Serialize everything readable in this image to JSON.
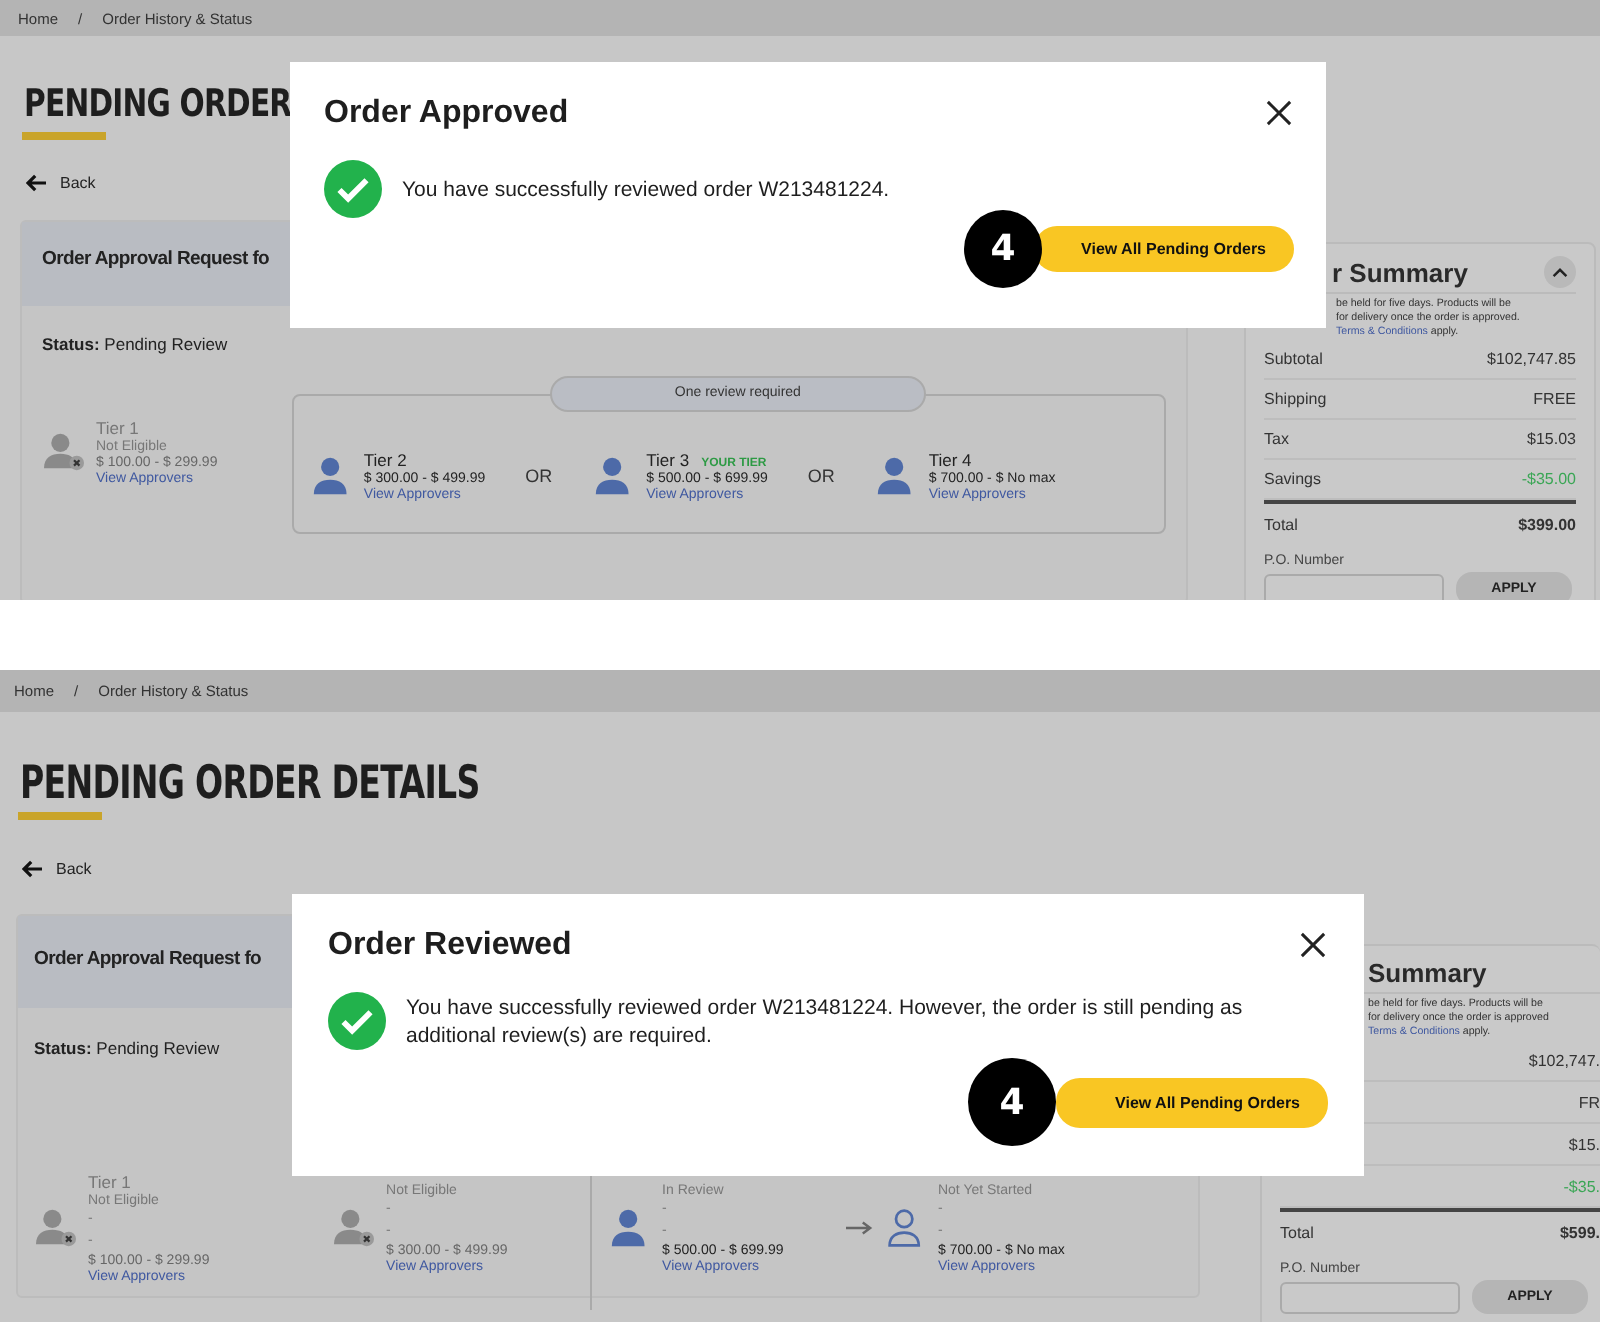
{
  "screens": [
    {
      "breadcrumb": [
        "Home",
        "Order History & Status"
      ],
      "separator": "/",
      "heading": "PENDING ORDER",
      "back": "Back",
      "request_title": "Order Approval Request fo",
      "status_label": "Status:",
      "status_value": "Pending Review",
      "tiers": [
        {
          "kind": "tier",
          "name": "Tier 1",
          "status": "Not Eligible",
          "range": "$ 100.00 - $ 299.99",
          "link": "View Approvers",
          "eligible": false
        },
        {
          "kind": "group",
          "label": "One review required",
          "items": [
            {
              "kind": "tier",
              "name": "Tier 2",
              "range": "$ 300.00 - $ 499.99",
              "link": "View Approvers",
              "eligible": true,
              "started": true
            },
            {
              "kind": "or",
              "text": "OR"
            },
            {
              "kind": "tier",
              "name": "Tier 3",
              "badge": "YOUR TIER",
              "range": "$ 500.00 - $ 699.99",
              "link": "View Approvers",
              "eligible": true,
              "started": true
            },
            {
              "kind": "or",
              "text": "OR"
            },
            {
              "kind": "tier",
              "name": "Tier 4",
              "range": "$ 700.00 - $ No max",
              "link": "View Approvers",
              "eligible": true,
              "started": true
            }
          ]
        }
      ],
      "summary": {
        "heading": "r Summary",
        "collapse": true,
        "note_lines": [
          "be held for five days. Products will be",
          "for delivery once the order is approved."
        ],
        "note_link": "Terms & Conditions",
        "note_tail": "apply.",
        "rows": [
          {
            "label": "Subtotal",
            "value": "$102,747.85",
            "kind": "plain"
          },
          {
            "label": "Shipping",
            "value": "FREE",
            "kind": "plain"
          },
          {
            "label": "Tax",
            "value": "$15.03",
            "kind": "plain"
          },
          {
            "label": "Savings",
            "value": "-$35.00",
            "kind": "savings"
          },
          {
            "label": "Total",
            "value": "$399.00",
            "kind": "total"
          }
        ],
        "po_label": "P.O. Number",
        "apply": "APPLY"
      },
      "modal": {
        "title": "Order Approved",
        "message": "You have successfully reviewed order W213481224.",
        "button": "View All Pending Orders",
        "step": "4"
      }
    },
    {
      "breadcrumb": [
        "Home",
        "Order History & Status"
      ],
      "separator": "/",
      "heading": "PENDING ORDER DETAILS",
      "back": "Back",
      "request_title": "Order Approval Request fo",
      "status_label": "Status:",
      "status_value": "Pending Review",
      "tiers": [
        {
          "kind": "tier",
          "name": "Tier 1",
          "status": "Not Eligible",
          "lines": [
            "-",
            "-"
          ],
          "range": "$ 100.00 - $ 299.99",
          "link": "View Approvers",
          "eligible": false
        },
        {
          "kind": "tier",
          "status": "Not Eligible",
          "lines": [
            "-",
            "-"
          ],
          "range": "$ 300.00 - $ 499.99",
          "link": "View Approvers",
          "eligible": false
        },
        {
          "kind": "divider"
        },
        {
          "kind": "tier",
          "status": "In Review",
          "lines": [
            "-",
            "-"
          ],
          "range": "$ 500.00 - $ 699.99",
          "link": "View Approvers",
          "eligible": true,
          "started": true
        },
        {
          "kind": "arrow"
        },
        {
          "kind": "tier",
          "status": "Not Yet Started",
          "lines": [
            "-",
            "-"
          ],
          "range": "$ 700.00 - $ No max",
          "link": "View Approvers",
          "eligible": true,
          "started": false
        }
      ],
      "summary": {
        "heading": "Summary",
        "note_lines": [
          "be held for five days. Products will be",
          "for delivery once the order is approved"
        ],
        "note_link": "Terms & Conditions",
        "note_tail": "apply.",
        "rows": [
          {
            "value": "$102,747.",
            "kind": "plain"
          },
          {
            "value": "FR",
            "kind": "plain"
          },
          {
            "value": "$15.",
            "kind": "plain"
          },
          {
            "value": "-$35.",
            "kind": "savings"
          },
          {
            "label": "Total",
            "value": "$599.",
            "kind": "total"
          }
        ],
        "po_label": "P.O. Number",
        "apply": "APPLY"
      },
      "modal": {
        "title": "Order Reviewed",
        "message": "You have successfully reviewed order W213481224. However, the order is still pending as additional review(s) are required.",
        "button": "View All Pending Orders",
        "step": "4"
      }
    }
  ]
}
